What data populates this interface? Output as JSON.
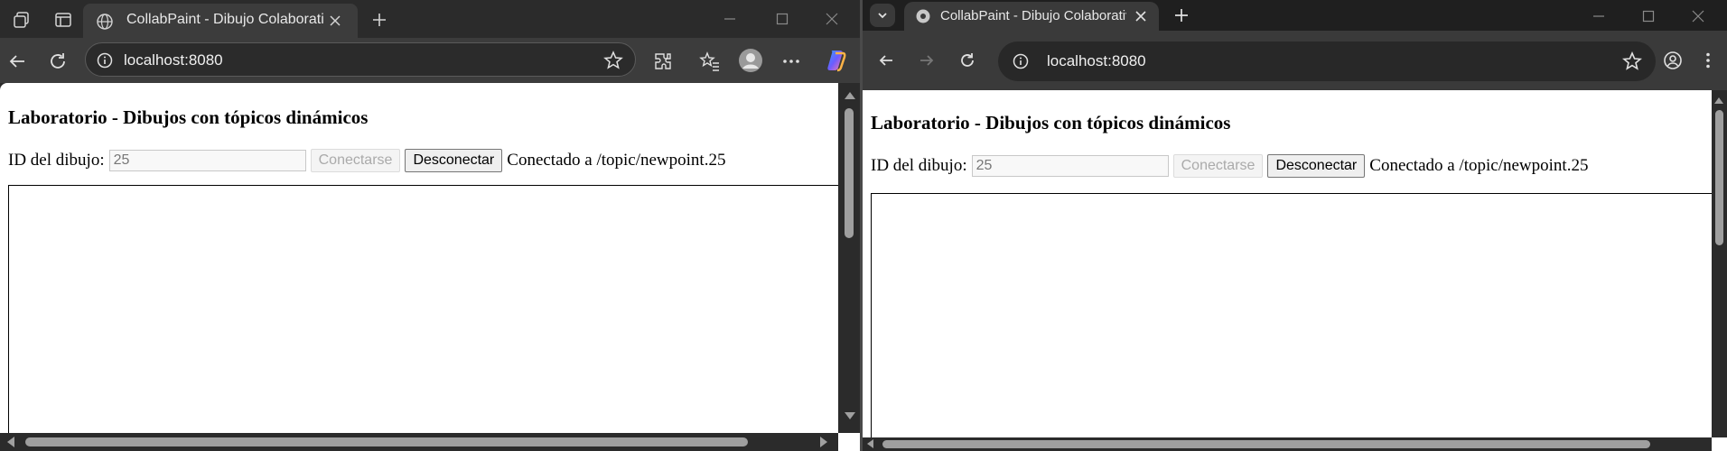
{
  "left_window": {
    "tab_title": "CollabPaint - Dibujo Colaborativo",
    "url": "localhost:8080",
    "page": {
      "heading": "Laboratorio - Dibujos con tópicos dinámicos",
      "id_label": "ID del dibujo:",
      "id_value": "25",
      "connect_label": "Conectarse",
      "disconnect_label": "Desconectar",
      "status": "Conectado a /topic/newpoint.25"
    }
  },
  "right_window": {
    "tab_title": "CollabPaint - Dibujo Colaborativo",
    "url": "localhost:8080",
    "page": {
      "heading": "Laboratorio - Dibujos con tópicos dinámicos",
      "id_label": "ID del dibujo:",
      "id_value": "25",
      "connect_label": "Conectarse",
      "disconnect_label": "Desconectar",
      "status": "Conectado a /topic/newpoint.25"
    }
  },
  "theme": {
    "dark_chrome": "#2b2b2b",
    "edge_toolbar": "#3c3c3c",
    "chrome_toolbar": "#3a3a3a",
    "copilot_accent": "#6b5cff"
  },
  "icons": [
    "workspaces-icon",
    "tab-actions-icon",
    "globe-icon",
    "close-icon",
    "new-tab-icon",
    "minimize-icon",
    "maximize-icon",
    "back-icon",
    "forward-icon",
    "reload-icon",
    "site-info-icon",
    "star-icon",
    "extensions-icon",
    "favorites-icon",
    "profile-icon",
    "more-icon",
    "copilot-icon",
    "tab-search-icon"
  ]
}
